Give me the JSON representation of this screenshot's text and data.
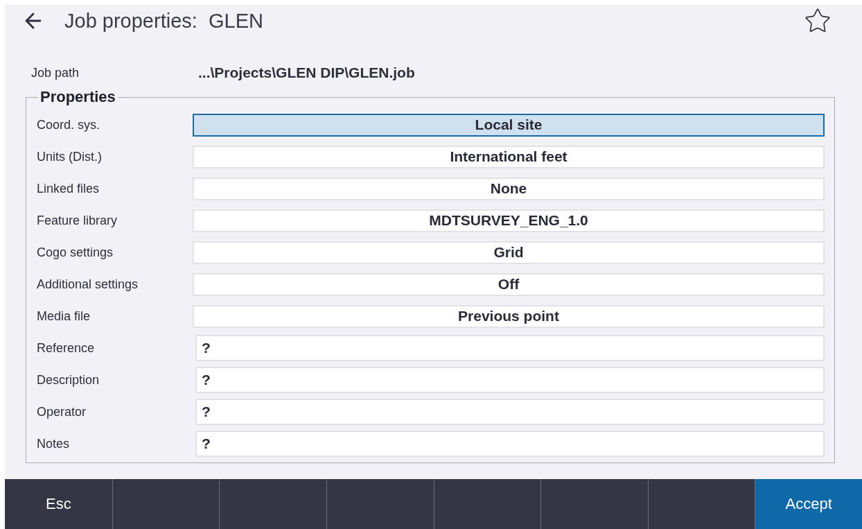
{
  "header": {
    "title": "Job properties:  GLEN",
    "favorite": false
  },
  "job_path": {
    "label": "Job path",
    "value": "...\\Projects\\GLEN DIP\\GLEN.job"
  },
  "properties": {
    "title": "Properties",
    "rows": [
      {
        "label": "Coord. sys.",
        "kind": "choice",
        "value": "Local site",
        "selected": true
      },
      {
        "label": "Units (Dist.)",
        "kind": "choice",
        "value": "International feet",
        "selected": false
      },
      {
        "label": "Linked files",
        "kind": "choice",
        "value": "None",
        "selected": false
      },
      {
        "label": "Feature library",
        "kind": "choice",
        "value": "MDTSURVEY_ENG_1.0",
        "selected": false
      },
      {
        "label": "Cogo settings",
        "kind": "choice",
        "value": "Grid",
        "selected": false
      },
      {
        "label": "Additional settings",
        "kind": "choice",
        "value": "Off",
        "selected": false
      },
      {
        "label": "Media file",
        "kind": "choice",
        "value": "Previous point",
        "selected": false
      },
      {
        "label": "Reference",
        "kind": "text",
        "value": "?",
        "selected": false
      },
      {
        "label": "Description",
        "kind": "text",
        "value": "?",
        "selected": false
      },
      {
        "label": "Operator",
        "kind": "text",
        "value": "?",
        "selected": false
      },
      {
        "label": "Notes",
        "kind": "text",
        "value": "?",
        "selected": false
      }
    ]
  },
  "softkeys": [
    {
      "kind": "key",
      "label": "Esc"
    },
    {
      "kind": "empty"
    },
    {
      "kind": "empty"
    },
    {
      "kind": "empty"
    },
    {
      "kind": "empty"
    },
    {
      "kind": "empty"
    },
    {
      "kind": "empty"
    },
    {
      "kind": "primary",
      "label": "Accept"
    }
  ]
}
